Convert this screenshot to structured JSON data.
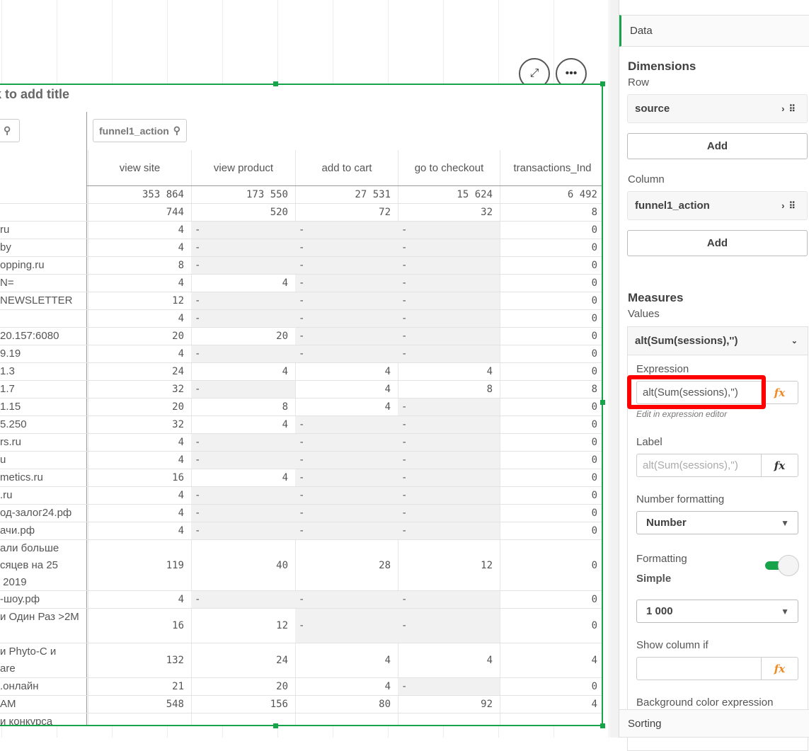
{
  "chart": {
    "title": "k to add title",
    "row_search": "",
    "col_search": "funnel1_action",
    "columns": [
      "view site",
      "view product",
      "add to cart",
      "go to checkout",
      "transactions_Ind"
    ],
    "rows": [
      {
        "label": "",
        "values": [
          "353 864",
          "173 550",
          "27 531",
          "15 624",
          "6 492"
        ]
      },
      {
        "label": "",
        "values": [
          "744",
          "520",
          "72",
          "32",
          "8"
        ]
      },
      {
        "label": "ru",
        "values": [
          "4",
          "-",
          "-",
          "-",
          "0"
        ]
      },
      {
        "label": "by",
        "values": [
          "4",
          "-",
          "-",
          "-",
          "0"
        ]
      },
      {
        "label": "opping.ru",
        "values": [
          "8",
          "-",
          "-",
          "-",
          "0"
        ]
      },
      {
        "label": "N=",
        "values": [
          "4",
          "4",
          "-",
          "-",
          "0"
        ]
      },
      {
        "label": "NEWSLETTER",
        "values": [
          "12",
          "-",
          "-",
          "-",
          "0"
        ]
      },
      {
        "label": "",
        "values": [
          "4",
          "-",
          "-",
          "-",
          "0"
        ]
      },
      {
        "label": "20.157:6080",
        "values": [
          "20",
          "20",
          "-",
          "-",
          "0"
        ]
      },
      {
        "label": "9.19",
        "values": [
          "4",
          "-",
          "-",
          "-",
          "0"
        ]
      },
      {
        "label": "1.3",
        "values": [
          "24",
          "4",
          "4",
          "4",
          "0"
        ]
      },
      {
        "label": "1.7",
        "values": [
          "32",
          "-",
          "4",
          "8",
          "8"
        ]
      },
      {
        "label": "1.15",
        "values": [
          "20",
          "8",
          "4",
          "-",
          "0"
        ]
      },
      {
        "label": "5.250",
        "values": [
          "32",
          "4",
          "-",
          "-",
          "0"
        ]
      },
      {
        "label": "rs.ru",
        "values": [
          "4",
          "-",
          "-",
          "-",
          "0"
        ]
      },
      {
        "label": "u",
        "values": [
          "4",
          "-",
          "-",
          "-",
          "0"
        ]
      },
      {
        "label": "metics.ru",
        "values": [
          "16",
          "4",
          "-",
          "-",
          "0"
        ]
      },
      {
        "label": ".ru",
        "values": [
          "4",
          "-",
          "-",
          "-",
          "0"
        ]
      },
      {
        "label": "од-залог24.рф",
        "values": [
          "4",
          "-",
          "-",
          "-",
          "0"
        ]
      },
      {
        "label": "ачи.рф",
        "values": [
          "4",
          "-",
          "-",
          "-",
          "0"
        ]
      },
      {
        "label": "али больше\nсяцев на 25\n 2019",
        "values": [
          "119",
          "40",
          "28",
          "12",
          "0"
        ]
      },
      {
        "label": "-шоу.рф",
        "values": [
          "4",
          "-",
          "-",
          "-",
          "0"
        ]
      },
      {
        "label": "и Один Раз >2M\n ",
        "values": [
          "16",
          "12",
          "-",
          "-",
          "0"
        ]
      },
      {
        "label": "и Phyto-C и\nare",
        "values": [
          "132",
          "24",
          "4",
          "4",
          "4"
        ]
      },
      {
        "label": ".онлайн",
        "values": [
          "21",
          "20",
          "4",
          "-",
          "0"
        ]
      },
      {
        "label": "AM",
        "values": [
          "548",
          "156",
          "80",
          "92",
          "4"
        ]
      },
      {
        "label": "и конкурса",
        "values": [
          "",
          "",
          "",
          "",
          ""
        ]
      }
    ]
  },
  "panel": {
    "tab_data": "Data",
    "dimensions": "Dimensions",
    "row": "Row",
    "row_dim": "source",
    "add": "Add",
    "column": "Column",
    "col_dim": "funnel1_action",
    "measures": "Measures",
    "values": "Values",
    "measure": "alt(Sum(sessions),'')",
    "expression_label": "Expression",
    "expression": "alt(Sum(sessions),'')",
    "edit_hint": "Edit in expression editor",
    "label_label": "Label",
    "label_placeholder": "alt(Sum(sessions),'')",
    "fx": "fx",
    "number_formatting": "Number formatting",
    "number_format_value": "Number",
    "formatting": "Formatting",
    "formatting_mode": "Simple",
    "format_pattern": "1 000",
    "show_column_if": "Show column if",
    "bg_color_expr": "Background color expression",
    "sorting": "Sorting"
  },
  "colors": {
    "accent": "#17a34a",
    "highlight": "#ff0000",
    "fx": "#f08a24"
  }
}
